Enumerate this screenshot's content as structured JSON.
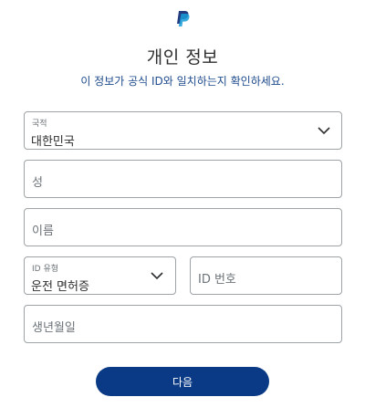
{
  "header": {
    "logo": "paypal-logo",
    "title": "개인 정보",
    "subtitle": "이 정보가 공식 ID와 일치하는지 확인하세요."
  },
  "form": {
    "country": {
      "label": "국적",
      "value": "대한민국",
      "icon": "chevron-down-icon"
    },
    "last_name": {
      "placeholder": "성"
    },
    "first_name": {
      "placeholder": "이름"
    },
    "id_type": {
      "label": "ID 유형",
      "value": "운전 면허증",
      "icon": "chevron-down-icon"
    },
    "id_number": {
      "placeholder": "ID 번호"
    },
    "birth_date": {
      "placeholder": "생년월일"
    }
  },
  "actions": {
    "next_label": "다음"
  },
  "colors": {
    "brand": "#0a3a85",
    "subtitle": "#1d4a8c",
    "border": "#9da3a6"
  }
}
